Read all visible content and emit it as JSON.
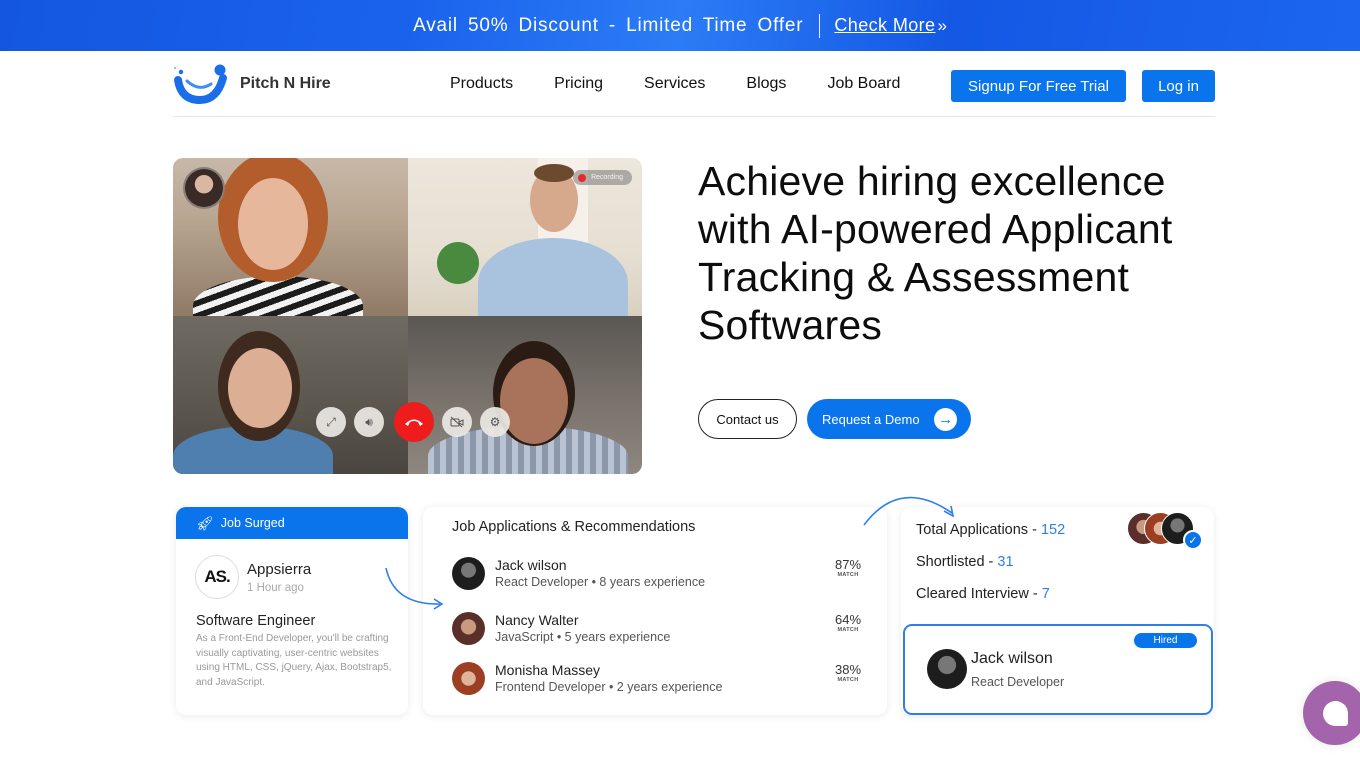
{
  "promo": {
    "text": "Avail 50% Discount - Limited Time Offer",
    "link": "Check More",
    "link_icon": "double-chevron-right-icon"
  },
  "nav": {
    "brand": "Pitch N Hire",
    "items": [
      "Products",
      "Pricing",
      "Services",
      "Blogs",
      "Job Board"
    ],
    "signup": "Signup For Free Trial",
    "login": "Log in"
  },
  "hero": {
    "title": "Achieve hiring excellence with AI-powered Applicant Tracking & Assessment Softwares",
    "contact": "Contact us",
    "demo": "Request a Demo",
    "video": {
      "recording_label": "Recording",
      "controls": [
        "fullscreen-icon",
        "volume-icon",
        "end-call-icon",
        "camera-off-icon",
        "settings-icon"
      ]
    }
  },
  "job_card": {
    "header": "Job Surged",
    "company_logo": "AS.",
    "company": "Appsierra",
    "time": "1 Hour ago",
    "title": "Software Engineer",
    "description": "As a Front-End Developer, you'll be crafting visually captivating, user-centric websites using HTML, CSS, jQuery, Ajax, Bootstrap5, and JavaScript."
  },
  "applications": {
    "title": "Job Applications & Recommendations",
    "match_label": "MATCH",
    "rows": [
      {
        "name": "Jack wilson",
        "meta": "React Developer • 8 years experience",
        "match": "87%"
      },
      {
        "name": "Nancy Walter",
        "meta": "JavaScript • 5 years experience",
        "match": "64%"
      },
      {
        "name": "Monisha Massey",
        "meta": "Frontend Developer • 2 years experience",
        "match": "38%"
      }
    ]
  },
  "stats": {
    "total_label": "Total Applications - ",
    "total": "152",
    "shortlisted_label": "Shortlisted - ",
    "shortlisted": "31",
    "cleared_label": "Cleared Interview - ",
    "cleared": "7",
    "hired": {
      "badge": "Hired",
      "name": "Jack wilson",
      "role": "React Developer"
    }
  },
  "colors": {
    "brand_blue": "#0a74ed",
    "end_call_red": "#ee1c1c",
    "chat_purple": "#a464ac"
  }
}
